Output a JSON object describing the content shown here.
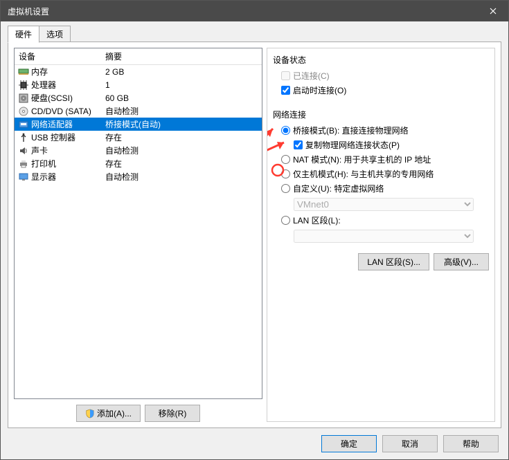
{
  "window": {
    "title": "虚拟机设置"
  },
  "tabs": {
    "hardware": "硬件",
    "options": "选项"
  },
  "hwHeader": {
    "device": "设备",
    "summary": "摘要"
  },
  "hw": [
    {
      "name": "内存",
      "summary": "2 GB",
      "icon": "memory"
    },
    {
      "name": "处理器",
      "summary": "1",
      "icon": "cpu"
    },
    {
      "name": "硬盘(SCSI)",
      "summary": "60 GB",
      "icon": "disk"
    },
    {
      "name": "CD/DVD (SATA)",
      "summary": "自动检测",
      "icon": "cd"
    },
    {
      "name": "网络适配器",
      "summary": "桥接模式(自动)",
      "icon": "net"
    },
    {
      "name": "USB 控制器",
      "summary": "存在",
      "icon": "usb"
    },
    {
      "name": "声卡",
      "summary": "自动检测",
      "icon": "sound"
    },
    {
      "name": "打印机",
      "summary": "存在",
      "icon": "printer"
    },
    {
      "name": "显示器",
      "summary": "自动检测",
      "icon": "display"
    }
  ],
  "leftButtons": {
    "add": "添加(A)...",
    "remove": "移除(R)"
  },
  "status": {
    "title": "设备状态",
    "connected": "已连接(C)",
    "connectOnPower": "启动时连接(O)"
  },
  "net": {
    "title": "网络连接",
    "bridged": "桥接模式(B): 直接连接物理网络",
    "replicate": "复制物理网络连接状态(P)",
    "nat": "NAT 模式(N): 用于共享主机的 IP 地址",
    "hostonly": "仅主机模式(H): 与主机共享的专用网络",
    "custom": "自定义(U): 特定虚拟网络",
    "customValue": "VMnet0",
    "lanSegment": "LAN 区段(L):"
  },
  "rightButtons": {
    "lanSeg": "LAN 区段(S)...",
    "advanced": "高级(V)..."
  },
  "bottom": {
    "ok": "确定",
    "cancel": "取消",
    "help": "帮助"
  }
}
